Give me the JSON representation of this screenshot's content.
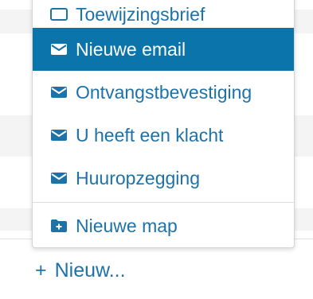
{
  "menu": {
    "items": [
      {
        "label": "Toewijzingsbrief",
        "icon": "envelope-icon"
      },
      {
        "label": "Nieuwe email",
        "icon": "envelope-icon",
        "active": true
      },
      {
        "label": "Ontvangstbevestiging",
        "icon": "envelope-icon"
      },
      {
        "label": "U heeft een klacht",
        "icon": "envelope-icon"
      },
      {
        "label": "Huuropzegging",
        "icon": "envelope-icon"
      }
    ],
    "new_folder": {
      "label": "Nieuwe map",
      "icon": "folder-plus-icon"
    }
  },
  "new_link": {
    "plus": "+",
    "label": "Nieuw..."
  },
  "colors": {
    "accent": "#0b74aa",
    "link": "#1d72a8",
    "active_text": "#ffffff"
  }
}
